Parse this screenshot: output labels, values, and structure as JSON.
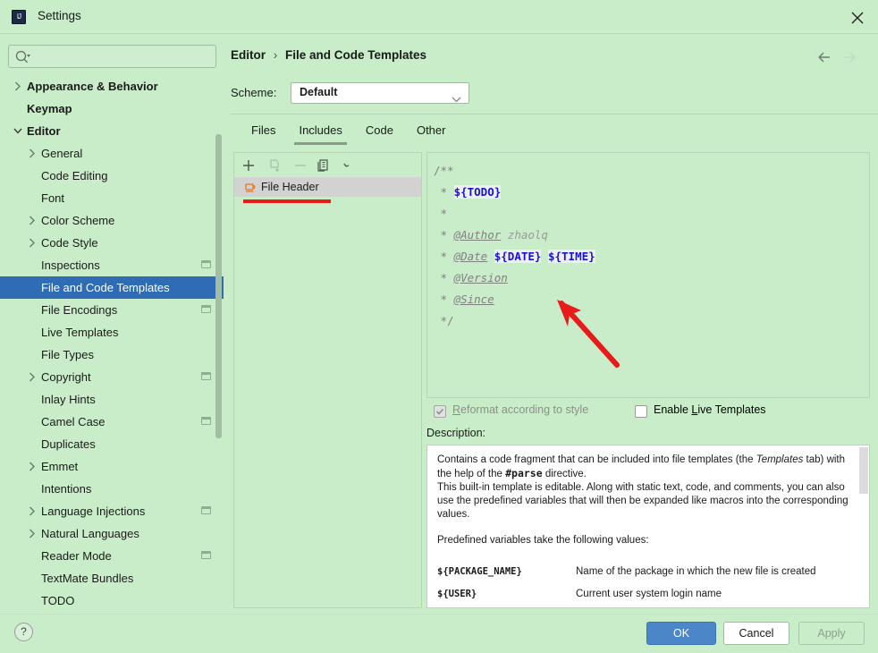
{
  "window": {
    "title": "Settings",
    "app_icon": "intellij-idea-icon",
    "close_icon": "close-icon"
  },
  "search": {
    "value": "",
    "placeholder": "",
    "icon": "search-icon"
  },
  "sidebar": {
    "items": [
      {
        "label": "Appearance & Behavior",
        "level": 1,
        "arrow": "collapsed",
        "selected": false,
        "badge": false
      },
      {
        "label": "Keymap",
        "level": 1,
        "arrow": "none",
        "selected": false,
        "badge": false
      },
      {
        "label": "Editor",
        "level": 1,
        "arrow": "expanded",
        "selected": false,
        "badge": false
      },
      {
        "label": "General",
        "level": 2,
        "arrow": "collapsed",
        "selected": false,
        "badge": false
      },
      {
        "label": "Code Editing",
        "level": 2,
        "arrow": "none",
        "selected": false,
        "badge": false
      },
      {
        "label": "Font",
        "level": 2,
        "arrow": "none",
        "selected": false,
        "badge": false
      },
      {
        "label": "Color Scheme",
        "level": 2,
        "arrow": "collapsed",
        "selected": false,
        "badge": false
      },
      {
        "label": "Code Style",
        "level": 2,
        "arrow": "collapsed",
        "selected": false,
        "badge": false
      },
      {
        "label": "Inspections",
        "level": 2,
        "arrow": "none",
        "selected": false,
        "badge": true
      },
      {
        "label": "File and Code Templates",
        "level": 2,
        "arrow": "none",
        "selected": true,
        "badge": false
      },
      {
        "label": "File Encodings",
        "level": 2,
        "arrow": "none",
        "selected": false,
        "badge": true
      },
      {
        "label": "Live Templates",
        "level": 2,
        "arrow": "none",
        "selected": false,
        "badge": false
      },
      {
        "label": "File Types",
        "level": 2,
        "arrow": "none",
        "selected": false,
        "badge": false
      },
      {
        "label": "Copyright",
        "level": 2,
        "arrow": "collapsed",
        "selected": false,
        "badge": true
      },
      {
        "label": "Inlay Hints",
        "level": 2,
        "arrow": "none",
        "selected": false,
        "badge": false
      },
      {
        "label": "Camel Case",
        "level": 2,
        "arrow": "none",
        "selected": false,
        "badge": true
      },
      {
        "label": "Duplicates",
        "level": 2,
        "arrow": "none",
        "selected": false,
        "badge": false
      },
      {
        "label": "Emmet",
        "level": 2,
        "arrow": "collapsed",
        "selected": false,
        "badge": false
      },
      {
        "label": "Intentions",
        "level": 2,
        "arrow": "none",
        "selected": false,
        "badge": false
      },
      {
        "label": "Language Injections",
        "level": 2,
        "arrow": "collapsed",
        "selected": false,
        "badge": true
      },
      {
        "label": "Natural Languages",
        "level": 2,
        "arrow": "collapsed",
        "selected": false,
        "badge": false
      },
      {
        "label": "Reader Mode",
        "level": 2,
        "arrow": "none",
        "selected": false,
        "badge": true
      },
      {
        "label": "TextMate Bundles",
        "level": 2,
        "arrow": "none",
        "selected": false,
        "badge": false
      },
      {
        "label": "TODO",
        "level": 2,
        "arrow": "none",
        "selected": false,
        "badge": false
      }
    ]
  },
  "breadcrumb": {
    "parent": "Editor",
    "separator": "›",
    "current": "File and Code Templates"
  },
  "nav": {
    "back_icon": "arrow-left-icon",
    "forward_icon": "arrow-right-icon"
  },
  "scheme": {
    "label": "Scheme:",
    "value": "Default",
    "options": [
      "Default"
    ],
    "chevron_icon": "chevron-down-icon"
  },
  "tabs": [
    {
      "label": "Files",
      "active": false
    },
    {
      "label": "Includes",
      "active": true
    },
    {
      "label": "Code",
      "active": false
    },
    {
      "label": "Other",
      "active": false
    }
  ],
  "list_toolbar": [
    {
      "icon": "plus-icon",
      "name": "add-template-button",
      "enabled": true
    },
    {
      "icon": "copy-file-icon",
      "name": "copy-template-button",
      "enabled": false
    },
    {
      "icon": "minus-icon",
      "name": "remove-template-button",
      "enabled": false
    },
    {
      "icon": "duplicate-icon",
      "name": "duplicate-template-button",
      "enabled": true
    },
    {
      "icon": "reset-icon",
      "name": "reset-template-button",
      "enabled": true
    }
  ],
  "template_list": [
    {
      "name": "File Header",
      "icon": "java-coffee-cup-icon",
      "selected": true
    }
  ],
  "editor": {
    "lines": [
      {
        "parts": [
          {
            "t": "/**",
            "s": "cl"
          }
        ]
      },
      {
        "parts": [
          {
            "t": " * ",
            "s": "cl"
          },
          {
            "t": "${TODO}",
            "s": "var"
          }
        ]
      },
      {
        "parts": [
          {
            "t": " *",
            "s": "cl"
          }
        ]
      },
      {
        "parts": [
          {
            "t": " * ",
            "s": "cl"
          },
          {
            "t": "@Author",
            "s": "tag"
          },
          {
            "t": " zhaolq",
            "s": "plain"
          }
        ]
      },
      {
        "parts": [
          {
            "t": " * ",
            "s": "cl"
          },
          {
            "t": "@Date",
            "s": "tag"
          },
          {
            "t": " ",
            "s": "cl"
          },
          {
            "t": "${DATE}",
            "s": "var"
          },
          {
            "t": " ",
            "s": "cl"
          },
          {
            "t": "${TIME}",
            "s": "var"
          }
        ]
      },
      {
        "parts": [
          {
            "t": " * ",
            "s": "cl"
          },
          {
            "t": "@Version",
            "s": "tag"
          }
        ]
      },
      {
        "parts": [
          {
            "t": " * ",
            "s": "cl"
          },
          {
            "t": "@Since",
            "s": "tag"
          }
        ]
      },
      {
        "parts": [
          {
            "t": " */",
            "s": "cl"
          }
        ]
      }
    ]
  },
  "options": {
    "reformat": {
      "label_prefix": "R",
      "label_rest": "eformat according to style",
      "checked": true,
      "enabled": false
    },
    "live_templates": {
      "label_a": "Enable ",
      "label_u": "L",
      "label_b": "ive Templates",
      "checked": false,
      "enabled": true
    }
  },
  "description": {
    "label": "Description:",
    "para1_a": "Contains a code fragment that can be included into file templates (the ",
    "para1_it": "Templates",
    "para1_b": " tab) with the help of the ",
    "para1_bd": "#parse",
    "para1_c": " directive.",
    "para2": "This built-in template is editable. Along with static text, code, and comments, you can also use the predefined variables that will then be expanded like macros into the corresponding values.",
    "para3": "Predefined variables take the following values:",
    "variables": [
      {
        "key": "${PACKAGE_NAME}",
        "value": "Name of the package in which the new file is created"
      },
      {
        "key": "${USER}",
        "value": "Current user system login name"
      }
    ]
  },
  "footer": {
    "help_label": "?",
    "ok_label": "OK",
    "cancel_label": "Cancel",
    "apply_label": "Apply"
  },
  "annotations": {
    "underline_color": "#e81a1a",
    "arrow_color": "#e81a1a"
  }
}
